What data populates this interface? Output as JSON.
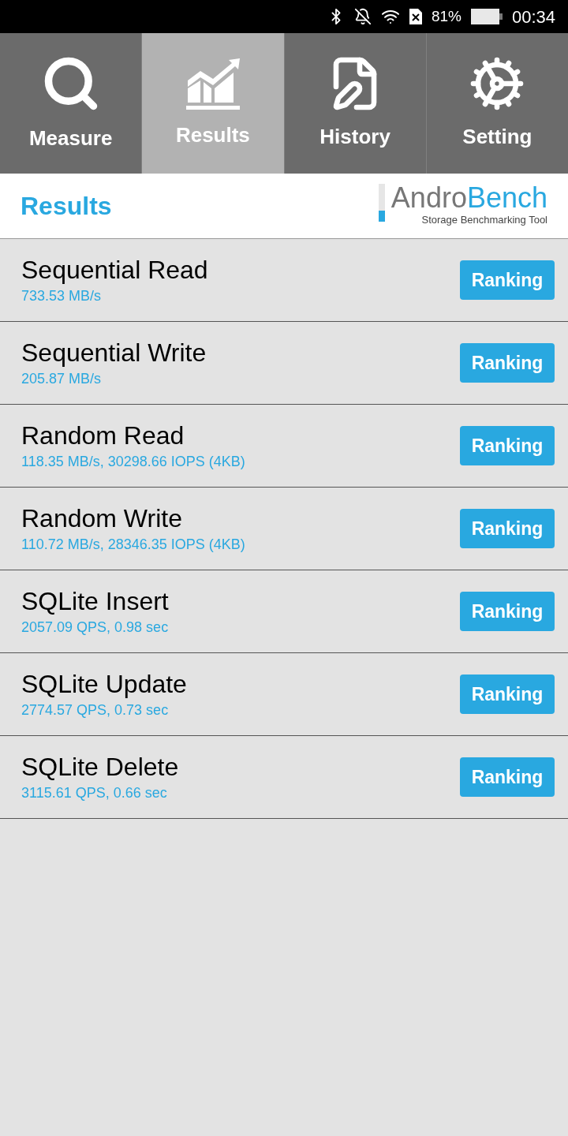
{
  "status_bar": {
    "battery": "81%",
    "time": "00:34"
  },
  "tabs": [
    {
      "label": "Measure",
      "kind": "search",
      "selected": false
    },
    {
      "label": "Results",
      "kind": "chart",
      "selected": true
    },
    {
      "label": "History",
      "kind": "document",
      "selected": false
    },
    {
      "label": "Setting",
      "kind": "gears",
      "selected": false
    }
  ],
  "header": {
    "title": "Results",
    "logo_first": "Andro",
    "logo_second": "Bench",
    "tagline": "Storage Benchmarking Tool"
  },
  "results": [
    {
      "name": "Sequential Read",
      "value": "733.53 MB/s",
      "button": "Ranking"
    },
    {
      "name": "Sequential Write",
      "value": "205.87 MB/s",
      "button": "Ranking"
    },
    {
      "name": "Random Read",
      "value": "118.35 MB/s, 30298.66 IOPS (4KB)",
      "button": "Ranking"
    },
    {
      "name": "Random Write",
      "value": "110.72 MB/s, 28346.35 IOPS (4KB)",
      "button": "Ranking"
    },
    {
      "name": "SQLite Insert",
      "value": "2057.09 QPS, 0.98 sec",
      "button": "Ranking"
    },
    {
      "name": "SQLite Update",
      "value": "2774.57 QPS, 0.73 sec",
      "button": "Ranking"
    },
    {
      "name": "SQLite Delete",
      "value": "3115.61 QPS, 0.66 sec",
      "button": "Ranking"
    }
  ]
}
